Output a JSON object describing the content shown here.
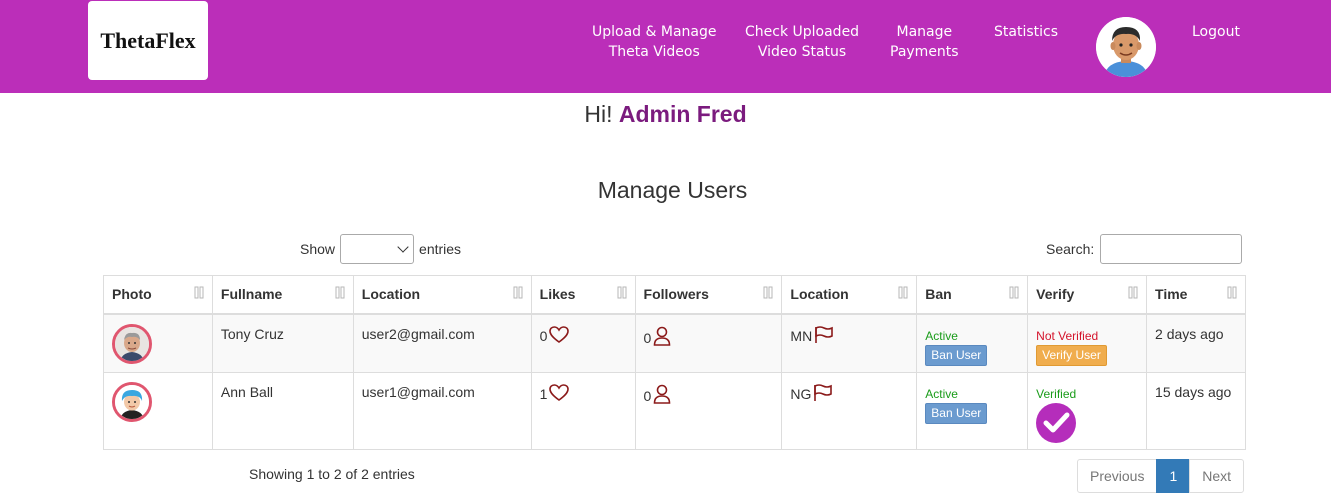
{
  "brand": "ThetaFlex",
  "nav": {
    "upload_line1": "Upload & Manage",
    "upload_line2": "Theta Videos",
    "check_line1": "Check Uploaded",
    "check_line2": "Video Status",
    "payments_line1": "Manage",
    "payments_line2": "Payments",
    "statistics": "Statistics",
    "logout": "Logout"
  },
  "greeting": {
    "prefix": "Hi!",
    "name": "Admin Fred"
  },
  "page_title": "Manage Users",
  "controls": {
    "show_label": "Show",
    "entries_label": "entries",
    "search_label": "Search:",
    "search_value": ""
  },
  "table": {
    "headers": [
      "Photo",
      "Fullname",
      "Location",
      "Likes",
      "Followers",
      "Location",
      "Ban",
      "Verify",
      "Time"
    ],
    "rows": [
      {
        "fullname": "Tony Cruz",
        "email": "user2@gmail.com",
        "likes": "0",
        "followers": "0",
        "country": "MN",
        "ban_status": "Active",
        "ban_button": "Ban User",
        "verify_status": "Not Verified",
        "verify_button": "Verify User",
        "time": "2 days ago"
      },
      {
        "fullname": "Ann Ball",
        "email": "user1@gmail.com",
        "likes": "1",
        "followers": "0",
        "country": "NG",
        "ban_status": "Active",
        "ban_button": "Ban User",
        "verify_status": "Verified",
        "verify_button": "",
        "time": "15 days ago"
      }
    ]
  },
  "footer": {
    "info": "Showing 1 to 2 of 2 entries",
    "previous": "Previous",
    "current_page": "1",
    "next": "Next"
  },
  "colors": {
    "navbar": "#bb2eb9",
    "admin_name": "#7b1b7e",
    "verified_badge": "#b52dbb",
    "page_active": "#337ab7"
  }
}
